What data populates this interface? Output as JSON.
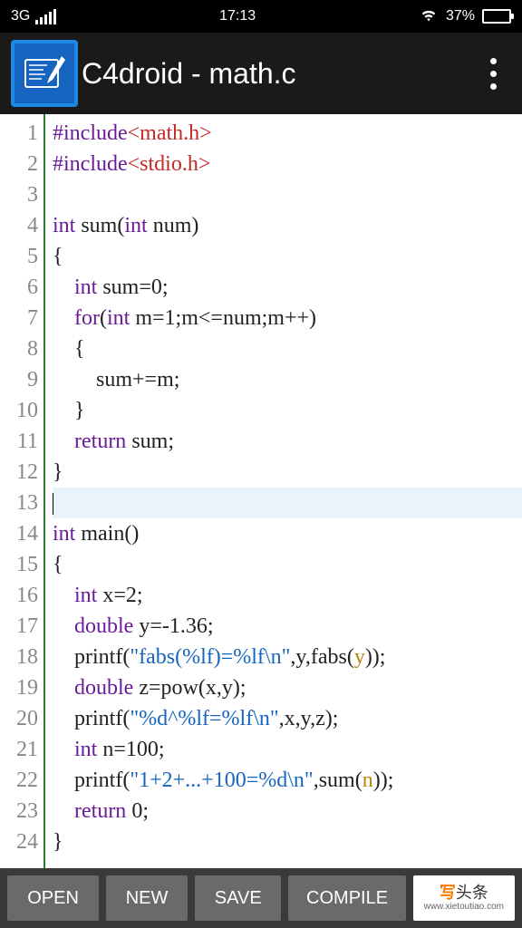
{
  "status": {
    "network": "3G",
    "time": "17:13",
    "battery_pct": "37%"
  },
  "app": {
    "title": "C4droid - math.c"
  },
  "gutter": [
    "1",
    "2",
    "3",
    "4",
    "5",
    "6",
    "7",
    "8",
    "9",
    "10",
    "11",
    "12",
    "13",
    "14",
    "15",
    "16",
    "17",
    "18",
    "19",
    "20",
    "21",
    "22",
    "23",
    "24"
  ],
  "code": {
    "current_line": 13,
    "lines": [
      [
        {
          "t": "#include",
          "c": "pp"
        },
        {
          "t": "<math.h>",
          "c": "inc"
        }
      ],
      [
        {
          "t": "#include",
          "c": "pp"
        },
        {
          "t": "<stdio.h>",
          "c": "inc"
        }
      ],
      [],
      [
        {
          "t": "int",
          "c": "kw"
        },
        {
          "t": " sum("
        },
        {
          "t": "int",
          "c": "kw"
        },
        {
          "t": " num)"
        }
      ],
      [
        {
          "t": "{"
        }
      ],
      [
        {
          "t": "    "
        },
        {
          "t": "int",
          "c": "kw"
        },
        {
          "t": " sum=0;"
        }
      ],
      [
        {
          "t": "    "
        },
        {
          "t": "for",
          "c": "kw"
        },
        {
          "t": "("
        },
        {
          "t": "int",
          "c": "kw"
        },
        {
          "t": " m=1;m<=num;m++)"
        }
      ],
      [
        {
          "t": "    {"
        }
      ],
      [
        {
          "t": "        sum+=m;"
        }
      ],
      [
        {
          "t": "    }"
        }
      ],
      [
        {
          "t": "    "
        },
        {
          "t": "return",
          "c": "kw"
        },
        {
          "t": " sum;"
        }
      ],
      [
        {
          "t": "}"
        }
      ],
      [],
      [
        {
          "t": "int",
          "c": "kw"
        },
        {
          "t": " main()"
        }
      ],
      [
        {
          "t": "{"
        }
      ],
      [
        {
          "t": "    "
        },
        {
          "t": "int",
          "c": "kw"
        },
        {
          "t": " x=2;"
        }
      ],
      [
        {
          "t": "    "
        },
        {
          "t": "double",
          "c": "kw"
        },
        {
          "t": " y=-1.36;"
        }
      ],
      [
        {
          "t": "    printf("
        },
        {
          "t": "\"fabs(%lf)=%lf\\n\"",
          "c": "str"
        },
        {
          "t": ",y,fabs("
        },
        {
          "t": "y",
          "c": "fn-call"
        },
        {
          "t": "));"
        }
      ],
      [
        {
          "t": "    "
        },
        {
          "t": "double",
          "c": "kw"
        },
        {
          "t": " z=pow(x,y);"
        }
      ],
      [
        {
          "t": "    printf("
        },
        {
          "t": "\"%d^%lf=%lf\\n\"",
          "c": "str"
        },
        {
          "t": ",x,y,z);"
        }
      ],
      [
        {
          "t": "    "
        },
        {
          "t": "int",
          "c": "kw"
        },
        {
          "t": " n=100;"
        }
      ],
      [
        {
          "t": "    printf("
        },
        {
          "t": "\"1+2+...+100=%d\\n\"",
          "c": "str"
        },
        {
          "t": ",sum("
        },
        {
          "t": "n",
          "c": "fn-call"
        },
        {
          "t": "));"
        }
      ],
      [
        {
          "t": "    "
        },
        {
          "t": "return",
          "c": "kw"
        },
        {
          "t": " 0;"
        }
      ],
      [
        {
          "t": "}"
        }
      ]
    ]
  },
  "buttons": {
    "open": "OPEN",
    "new": "NEW",
    "save": "SAVE",
    "compile": "COMPILE"
  },
  "watermark": {
    "line1_prefix": "写",
    "line1_suffix": "头条",
    "line2": "www.xietoutiao.com"
  }
}
